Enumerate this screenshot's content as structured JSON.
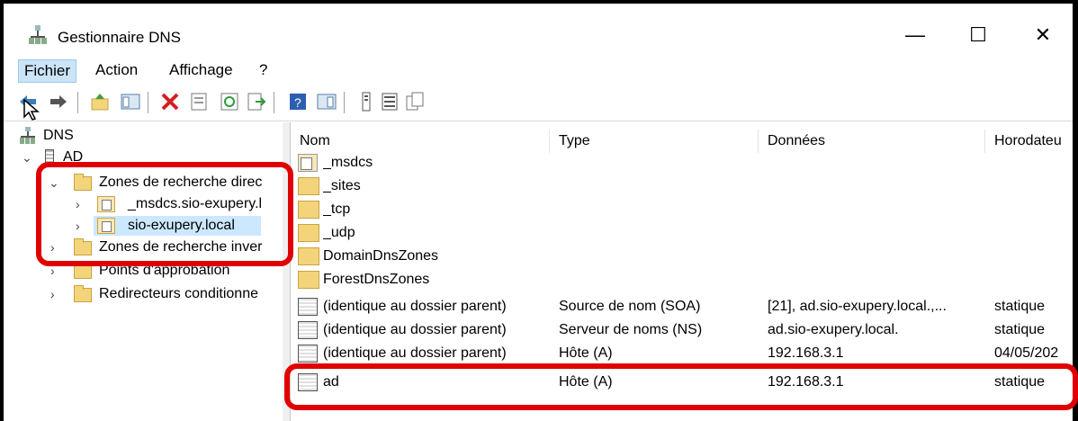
{
  "window": {
    "title": "Gestionnaire DNS",
    "controls": {
      "minimize": "—",
      "maximize": "☐",
      "close": "✕"
    }
  },
  "menu": {
    "file": "Fichier",
    "action": "Action",
    "view": "Affichage",
    "help": "?"
  },
  "toolbar": {
    "icons": [
      "back-icon",
      "forward-icon",
      "up-icon",
      "show-tree-icon",
      "delete-icon",
      "properties-icon",
      "refresh-icon",
      "export-icon",
      "help-icon",
      "console-icon",
      "record-icon",
      "list-icon",
      "copy-icon"
    ]
  },
  "tree": {
    "root": "DNS",
    "server": "AD",
    "forward_zones": "Zones de recherche direc",
    "msdcs_zone": "_msdcs.sio-exupery.l",
    "local_zone": "sio-exupery.local",
    "reverse_zones": "Zones de recherche inver",
    "trust_points": "Points d'approbation",
    "forwarders": "Redirecteurs conditionne"
  },
  "list": {
    "columns": {
      "name": "Nom",
      "type": "Type",
      "data": "Données",
      "timestamp": "Horodateu"
    },
    "rows": [
      {
        "icon": "zone",
        "name": "_msdcs",
        "type": "",
        "data": "",
        "timestamp": ""
      },
      {
        "icon": "folder",
        "name": "_sites",
        "type": "",
        "data": "",
        "timestamp": ""
      },
      {
        "icon": "folder",
        "name": "_tcp",
        "type": "",
        "data": "",
        "timestamp": ""
      },
      {
        "icon": "folder",
        "name": "_udp",
        "type": "",
        "data": "",
        "timestamp": ""
      },
      {
        "icon": "folder",
        "name": "DomainDnsZones",
        "type": "",
        "data": "",
        "timestamp": ""
      },
      {
        "icon": "folder",
        "name": "ForestDnsZones",
        "type": "",
        "data": "",
        "timestamp": ""
      },
      {
        "icon": "record",
        "name": "(identique au dossier parent)",
        "type": "Source de nom (SOA)",
        "data": "[21], ad.sio-exupery.local.,...",
        "timestamp": "statique"
      },
      {
        "icon": "record",
        "name": "(identique au dossier parent)",
        "type": "Serveur de noms (NS)",
        "data": "ad.sio-exupery.local.",
        "timestamp": "statique"
      },
      {
        "icon": "record",
        "name": "(identique au dossier parent)",
        "type": "Hôte (A)",
        "data": "192.168.3.1",
        "timestamp": "04/05/202"
      },
      {
        "icon": "record",
        "name": "ad",
        "type": "Hôte (A)",
        "data": "192.168.3.1",
        "timestamp": "statique"
      }
    ]
  },
  "colors": {
    "highlight": "#e00000",
    "selection": "#cce8ff",
    "folder": "#f3d47a"
  }
}
